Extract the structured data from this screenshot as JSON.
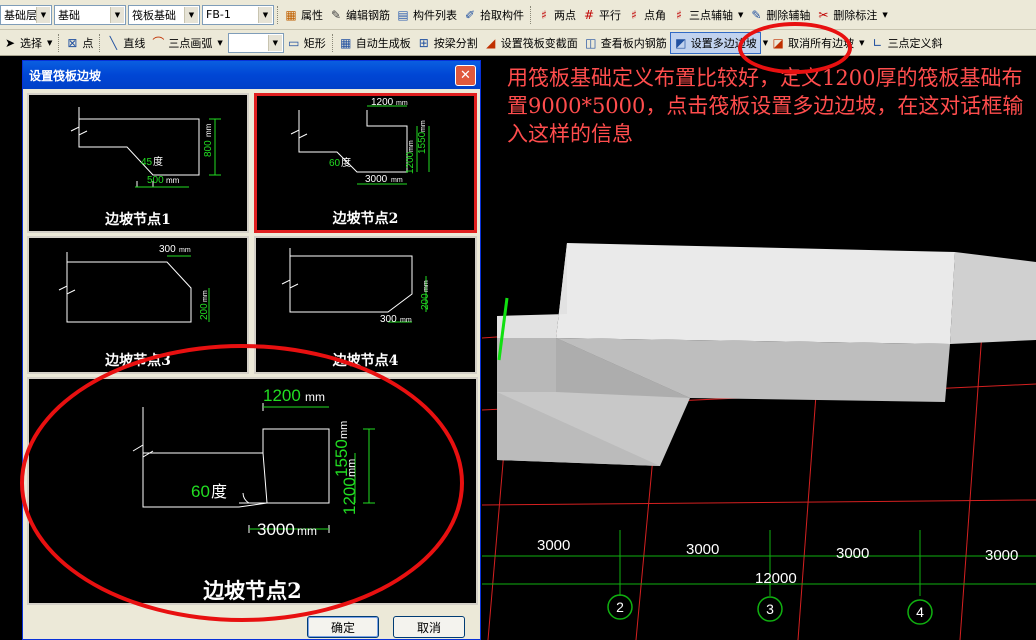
{
  "toolbar1": {
    "combo_floor": "基础层",
    "combo_category": "基础",
    "combo_component": "筏板基础",
    "combo_instance": "FB-1",
    "buttons": {
      "properties": "属性",
      "edit_rebar": "编辑钢筋",
      "component_list": "构件列表",
      "pick_component": "拾取构件",
      "two_point": "两点",
      "parallel": "平行",
      "point_angle": "点角",
      "three_point_axis": "三点辅轴",
      "delete_axis": "删除辅轴",
      "delete_dimension": "删除标注"
    }
  },
  "toolbar2": {
    "buttons": {
      "select": "选择",
      "point": "点",
      "line": "直线",
      "three_point_arc": "三点画弧",
      "rectangle": "矩形",
      "auto_generate": "自动生成板",
      "split_by_beam": "按梁分割",
      "set_variable_section": "设置筏板变截面",
      "view_rebar": "查看板内钢筋",
      "set_multi_slope": "设置多边边坡",
      "cancel_all_slopes": "取消所有边坡",
      "three_point_slope": "三点定义斜"
    }
  },
  "dialog": {
    "title": "设置筏板边坡",
    "close_glyph": "✕",
    "nodes": [
      {
        "label": "边坡节点1",
        "dim_vertical": "800",
        "dim_vertical_unit": "mm",
        "angle": "45",
        "angle_unit": "度",
        "dim_bottom": "500",
        "dim_bottom_unit": "mm"
      },
      {
        "label": "边坡节点2",
        "dim_top": "1200",
        "dim_top_unit": "mm",
        "dim_vertical_outer": "1550",
        "dim_vertical_outer_unit": "mm",
        "dim_vertical_inner": "1200",
        "dim_vertical_inner_unit": "mm",
        "angle": "60",
        "angle_unit": "度",
        "dim_bottom": "3000",
        "dim_bottom_unit": "mm"
      },
      {
        "label": "边坡节点3",
        "dim_top": "300",
        "dim_top_unit": "mm",
        "dim_vertical": "200",
        "dim_vertical_unit": "mm"
      },
      {
        "label": "边坡节点4",
        "dim_vertical": "200",
        "dim_vertical_unit": "mm",
        "dim_bottom": "300",
        "dim_bottom_unit": "mm"
      }
    ],
    "preview": {
      "label": "边坡节点2",
      "dim_top": "1200",
      "dim_top_unit": "mm",
      "dim_vertical_outer": "1550",
      "dim_vertical_outer_unit": "mm",
      "dim_vertical_inner": "1200",
      "dim_vertical_inner_unit": "mm",
      "angle": "60",
      "angle_unit": "度",
      "dim_bottom": "3000",
      "dim_bottom_unit": "mm"
    },
    "ok_label": "确定",
    "cancel_label": "取消"
  },
  "annotation_text": "用筏板基础定义布置比较好，定义1200厚的筏板基础布置9000*5000，点击筏板设置多边边坡，在这对话框输入这样的信息",
  "viewport": {
    "dims": [
      "3000",
      "3000",
      "3000",
      "3000"
    ],
    "total_dim": "12000",
    "axis_labels": [
      "2",
      "3",
      "4"
    ]
  },
  "colors": {
    "grid_red": "#D42020",
    "grid_green": "#10B010",
    "dim_green": "#22DD22",
    "annotation": "#FF4D4D",
    "highlight_circle": "#E81010",
    "title_blue": "#0046D5"
  }
}
